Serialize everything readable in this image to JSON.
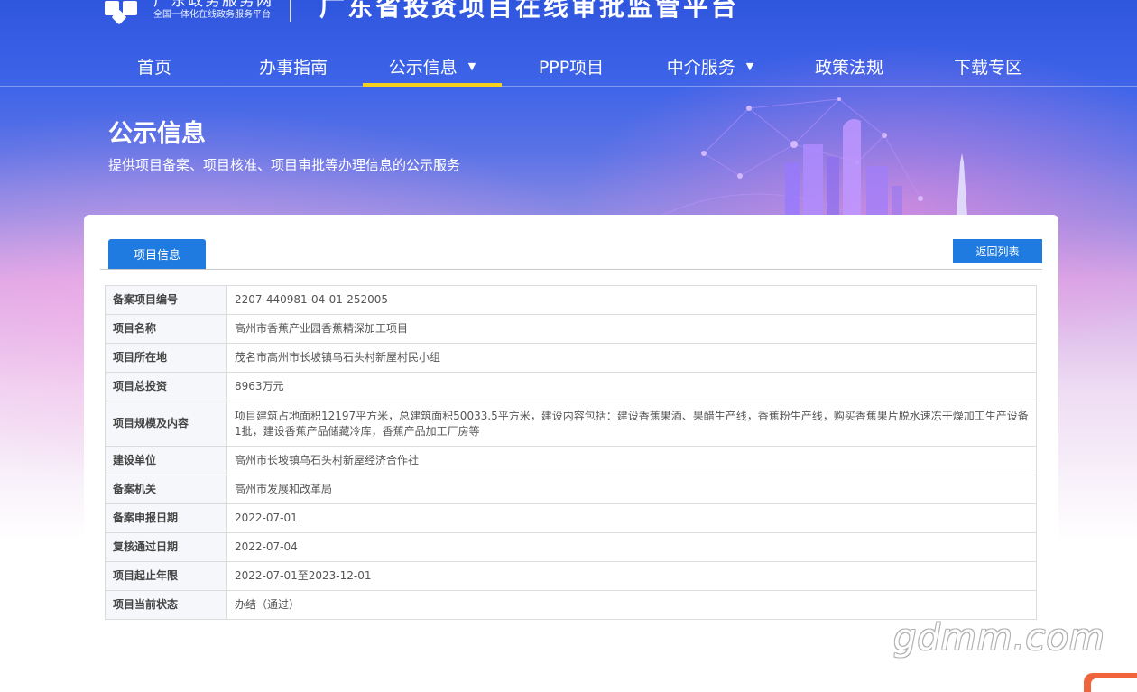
{
  "header": {
    "portal_name": "广东政务服务网",
    "portal_slogan": "全国一体化在线政务服务平台",
    "site_title": "广东省投资项目在线审批监管平台"
  },
  "nav": {
    "items": [
      {
        "label": "首页",
        "has_dropdown": false,
        "active": false
      },
      {
        "label": "办事指南",
        "has_dropdown": false,
        "active": false
      },
      {
        "label": "公示信息",
        "has_dropdown": true,
        "active": true
      },
      {
        "label": "PPP项目",
        "has_dropdown": false,
        "active": false
      },
      {
        "label": "中介服务",
        "has_dropdown": true,
        "active": false
      },
      {
        "label": "政策法规",
        "has_dropdown": false,
        "active": false
      },
      {
        "label": "下载专区",
        "has_dropdown": false,
        "active": false
      }
    ],
    "caret_icon": "▼",
    "active_underline_color": "#f5d01e"
  },
  "banner": {
    "title": "公示信息",
    "subtitle": "提供项目备案、项目核准、项目审批等办理信息的公示服务"
  },
  "panel": {
    "tab_label": "项目信息",
    "back_label": "返回列表",
    "accent_color": "#1f7be0"
  },
  "project": {
    "rows": [
      {
        "key": "备案项目编号",
        "value": "2207-440981-04-01-252005"
      },
      {
        "key": "项目名称",
        "value": "高州市香蕉产业园香蕉精深加工项目"
      },
      {
        "key": "项目所在地",
        "value": "茂名市高州市长坡镇乌石头村新屋村民小组"
      },
      {
        "key": "项目总投资",
        "value": "8963万元"
      },
      {
        "key": "项目规模及内容",
        "value": "项目建筑占地面积12197平方米，总建筑面积50033.5平方米，建设内容包括：建设香蕉果酒、果醋生产线，香蕉粉生产线，购买香蕉果片脱水速冻干燥加工生产设备1批，建设香蕉产品储藏冷库，香蕉产品加工厂房等"
      },
      {
        "key": "建设单位",
        "value": "高州市长坡镇乌石头村新屋经济合作社"
      },
      {
        "key": "备案机关",
        "value": "高州市发展和改革局"
      },
      {
        "key": "备案申报日期",
        "value": "2022-07-01"
      },
      {
        "key": "复核通过日期",
        "value": "2022-07-04"
      },
      {
        "key": "项目起止年限",
        "value": "2022-07-01至2023-12-01"
      },
      {
        "key": "项目当前状态",
        "value": "办结（通过）"
      }
    ]
  },
  "watermark": {
    "text": "gdmm.com"
  }
}
